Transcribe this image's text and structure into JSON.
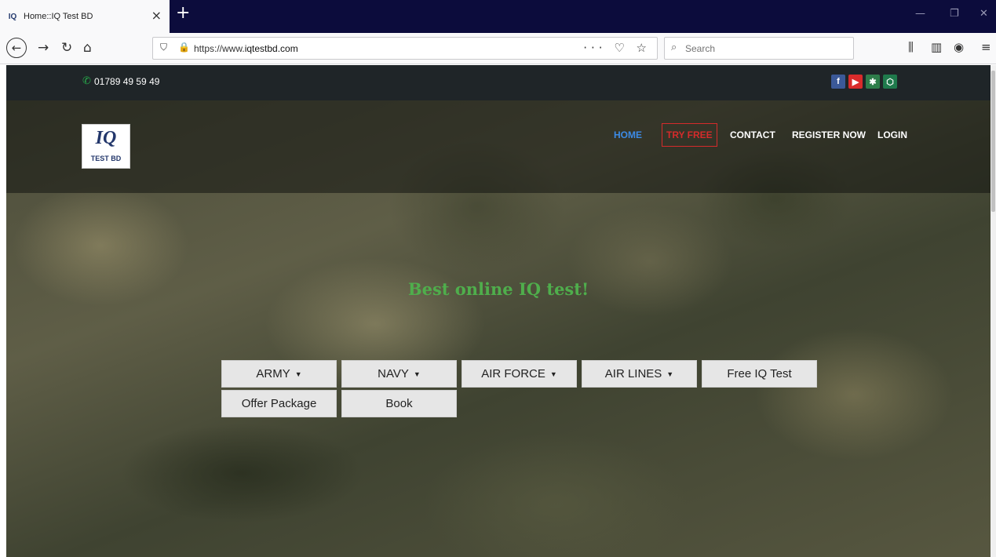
{
  "browser": {
    "tab_title": "Home::IQ Test BD",
    "tab_favicon": "iq-test-bd-favicon",
    "tab_close": "×",
    "new_tab": "+",
    "url_prefix": "https://www.",
    "url_host": "iqtestbd.com",
    "url_actions": "··· ♡ ☆",
    "search_placeholder": "Search",
    "window_controls": [
      "—",
      "❐",
      "✕"
    ],
    "toolbar_icons": [
      "library-icon",
      "sidebar-icon",
      "account-icon",
      "menu-icon"
    ]
  },
  "topbar": {
    "phone": "01789 49 59 49",
    "social": [
      {
        "name": "facebook-icon",
        "glyph": "f",
        "color": "#3b5998"
      },
      {
        "name": "youtube-icon",
        "glyph": "▶",
        "color": "#d92b2b"
      },
      {
        "name": "emblem-icon",
        "glyph": "✱",
        "color": "#2e7d4a"
      },
      {
        "name": "badge-icon",
        "glyph": "⬡",
        "color": "#1f7a4c"
      }
    ]
  },
  "logo": {
    "mark": "IQ",
    "text": "TEST BD"
  },
  "nav": {
    "home": "HOME",
    "try_free": "TRY FREE",
    "contact": "CONTACT",
    "register": "REGISTER NOW",
    "login": "LOGIN"
  },
  "hero": {
    "title": "Best online IQ test!"
  },
  "categories": [
    {
      "label": "ARMY",
      "dropdown": true
    },
    {
      "label": "NAVY",
      "dropdown": true
    },
    {
      "label": "AIR FORCE",
      "dropdown": true
    },
    {
      "label": "AIR LINES",
      "dropdown": true
    },
    {
      "label": "Free IQ Test",
      "dropdown": false
    },
    {
      "label": "Offer Package",
      "dropdown": false
    },
    {
      "label": "Book",
      "dropdown": false
    }
  ],
  "colors": {
    "accent_green": "#4fae4c",
    "try_red": "#d52b2b",
    "active_blue": "#3c8be6",
    "topstrip": "#1f2528"
  }
}
